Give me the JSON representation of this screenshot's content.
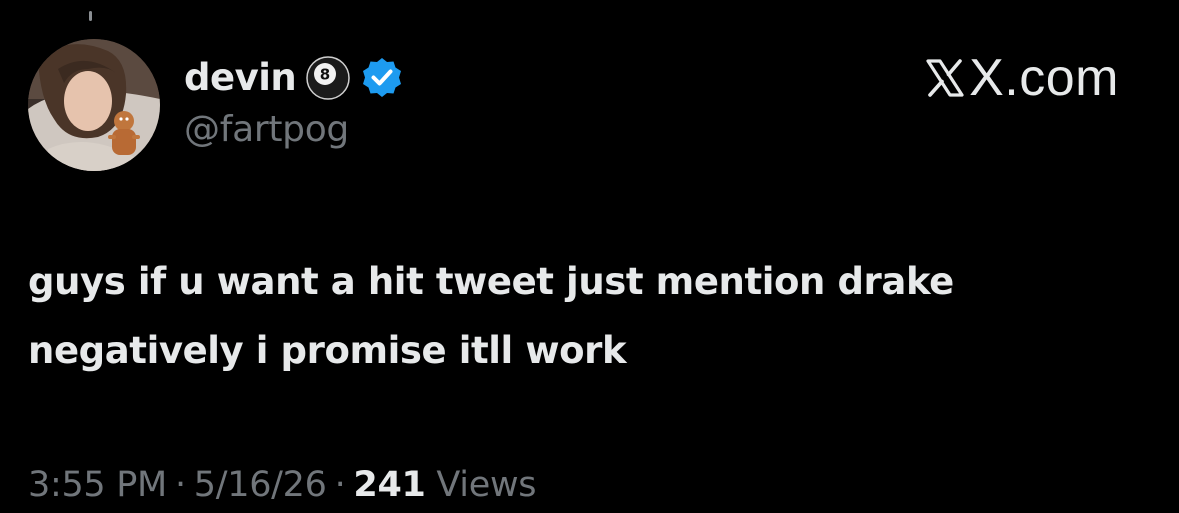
{
  "post": {
    "author": {
      "display_name": "devin",
      "handle": "@fartpog",
      "name_emoji": "eight-ball-icon",
      "verified": true,
      "verified_icon": "verified-badge-icon",
      "verified_color": "#1d9bf0",
      "avatar": "avatar-photo"
    },
    "brand": {
      "text": "X.com",
      "icon": "x-logo-icon"
    },
    "text_lines": [
      "guys if u want a hit tweet just mention drake",
      "negatively i promise itll work"
    ],
    "meta": {
      "time": "3:55 PM",
      "separator": "·",
      "date": "5/16/26",
      "views_count": "241",
      "views_label": "Views"
    }
  },
  "colors": {
    "background": "#000000",
    "primary_text": "#e7e9ea",
    "secondary_text": "#71767b",
    "accent": "#1d9bf0"
  }
}
